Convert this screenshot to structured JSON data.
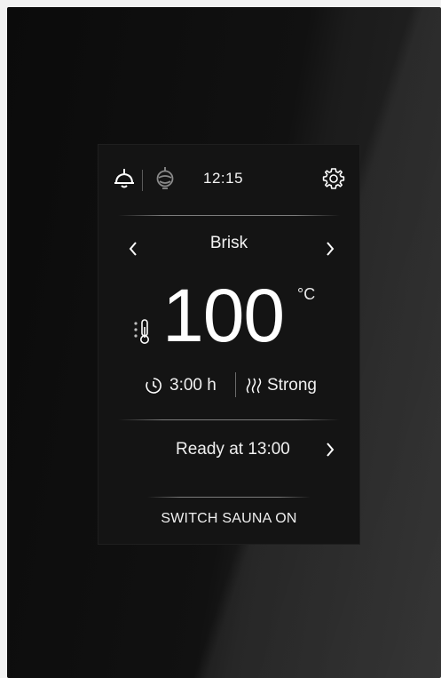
{
  "header": {
    "clock": "12:15",
    "icons": [
      "sauna-light-icon",
      "fan-icon",
      "gear-icon"
    ]
  },
  "program": {
    "name": "Brisk",
    "temperature": "100",
    "unit": "°C",
    "duration": "3:00 h",
    "intensity": "Strong"
  },
  "schedule": {
    "ready_label": "Ready at 13:00"
  },
  "action": {
    "switch_label": "SWITCH SAUNA ON"
  },
  "colors": {
    "screen_bg": "#141414",
    "text": "#ffffff",
    "divider": "#969696"
  }
}
